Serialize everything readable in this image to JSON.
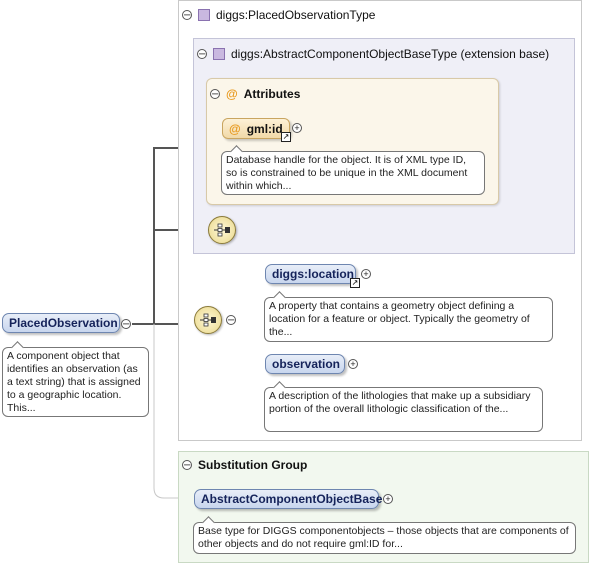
{
  "placed_observation_type": {
    "label": "diggs:PlacedObservationType",
    "collapse_symbol": "−"
  },
  "base_type": {
    "label": "diggs:AbstractComponentObjectBaseType (extension base)",
    "collapse_symbol": "−"
  },
  "attributes": {
    "label": "Attributes",
    "at_symbol": "@",
    "collapse_symbol": "−",
    "gml_id": {
      "label": "gml:id",
      "doc": "Database handle for the object. It is of XML type ID, so is constrained to be unique in the XML document within which..."
    }
  },
  "root_element": {
    "label": "PlacedObservation",
    "doc": "A component object that identifies an observation (as a text string) that is assigned to a geographic location. This..."
  },
  "children": [
    {
      "label": "diggs:location",
      "doc": "A property that contains a geometry object defining a location for a feature or object. Typically the geometry of the..."
    },
    {
      "label": "observation",
      "doc": "A description of the lithologies that make up a subsidiary portion of the overall lithologic classification of the..."
    }
  ],
  "substitution_group": {
    "label": "Substitution Group",
    "collapse_symbol": "−",
    "element": {
      "label": "AbstractComponentObjectBase",
      "doc": "Base type for DIGGS componentobjects – those objects that are components of other objects and do not require gml:ID for..."
    }
  },
  "symbols": {
    "plus": "+",
    "minus": "−",
    "ref_arrow": "↗"
  },
  "colors": {
    "element_pill": "#c8d6ee",
    "attribute_pill": "#f1d9a8",
    "connector": "#555555",
    "type_icon": "#c9b8e0"
  }
}
